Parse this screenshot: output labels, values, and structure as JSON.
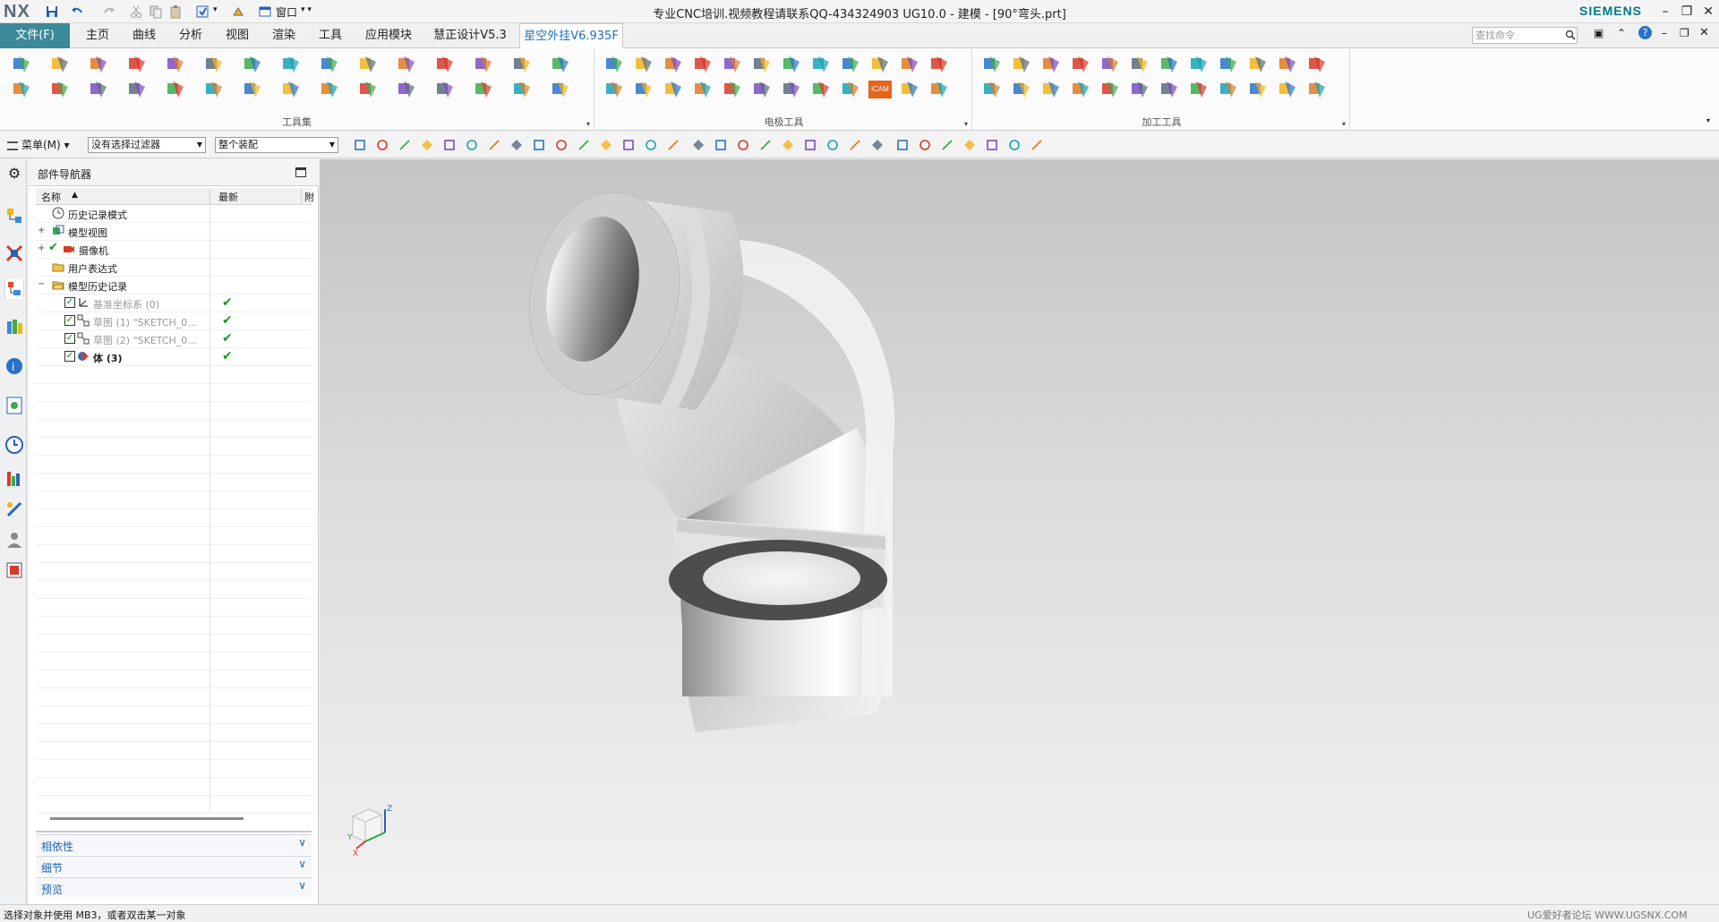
{
  "titlebar": {
    "app_logo": "NX",
    "window_label": "窗口",
    "title": "专业CNC培训.视频教程请联系QQ-434324903 UG10.0 - 建模 - [90°弯头.prt]",
    "brand": "SIEMENS",
    "icons": [
      "save-icon",
      "undo-icon",
      "redo-icon",
      "cut-icon",
      "copy-icon",
      "paste-icon",
      "repeat-command-icon",
      "touch-mode-icon",
      "window-icon"
    ]
  },
  "ribbon": {
    "file_tab": "文件(F)",
    "tabs": [
      "主页",
      "曲线",
      "分析",
      "视图",
      "渲染",
      "工具",
      "应用模块",
      "慧正设计V5.3",
      "星空外挂V6.935F"
    ],
    "active_tab": "星空外挂V6.935F",
    "search_placeholder": "查找命令",
    "groups": [
      {
        "label": "工具集"
      },
      {
        "label": "电极工具"
      },
      {
        "label": "加工工具"
      }
    ],
    "icam_label": "iCAM"
  },
  "selection_bar": {
    "menu_label": "菜单(M)",
    "filter_value": "没有选择过滤器",
    "scope_value": "整个装配"
  },
  "navigator": {
    "title": "部件导航器",
    "columns": {
      "name": "名称",
      "latest": "最新",
      "extra": "附"
    },
    "rows": [
      {
        "label": "历史记录模式",
        "icon": "history-mode-icon"
      },
      {
        "label": "模型视图",
        "icon": "model-views-icon"
      },
      {
        "label": "摄像机",
        "icon": "camera-icon"
      },
      {
        "label": "用户表达式",
        "icon": "folder-icon"
      },
      {
        "label": "模型历史记录",
        "icon": "folder-open-icon"
      },
      {
        "label": "基准坐标系 (0)",
        "icon": "datum-csys-icon"
      },
      {
        "label": "草图 (1) \"SKETCH_0...",
        "icon": "sketch-icon"
      },
      {
        "label": "草图 (2) \"SKETCH_0...",
        "icon": "sketch-icon"
      },
      {
        "label": "体 (3)",
        "icon": "body-icon"
      }
    ],
    "panels": [
      "相依性",
      "细节",
      "预览"
    ]
  },
  "triad": {
    "x": "X",
    "y": "Y",
    "z": "Z"
  },
  "status": {
    "prompt": "选择对象并使用 MB3，或者双击某一对象",
    "watermark": "UG爱好者论坛 WWW.UGSNX.COM"
  },
  "colors": {
    "file_tab": "#3a8a99",
    "active_tab_text": "#1e6fb7",
    "brand": "#007a8c",
    "check_green": "#1a9a1a",
    "panel_blue": "#1e63b4"
  }
}
